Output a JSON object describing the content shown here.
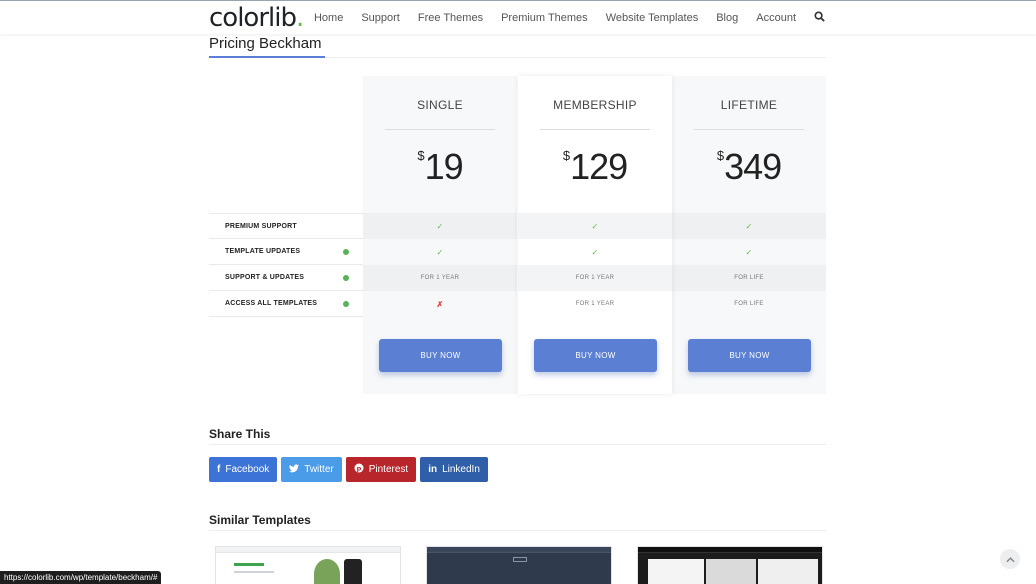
{
  "header": {
    "logo_text": "colorlib",
    "logo_dot": ".",
    "nav": [
      "Home",
      "Support",
      "Free Themes",
      "Premium Themes",
      "Website Templates",
      "Blog",
      "Account"
    ]
  },
  "page": {
    "title": "Pricing Beckham"
  },
  "pricing": {
    "features": [
      {
        "label": "PREMIUM SUPPORT",
        "help": false
      },
      {
        "label": "TEMPLATE UPDATES",
        "help": true
      },
      {
        "label": "SUPPORT & UPDATES",
        "help": true
      },
      {
        "label": "ACCESS ALL TEMPLATES",
        "help": true
      }
    ],
    "plans": [
      {
        "name": "SINGLE",
        "currency": "$",
        "price": "19",
        "cells": [
          "✓",
          "✓",
          "FOR 1 YEAR",
          "✗"
        ],
        "button": "BUY NOW"
      },
      {
        "name": "MEMBERSHIP",
        "currency": "$",
        "price": "129",
        "cells": [
          "✓",
          "✓",
          "FOR 1 YEAR",
          "FOR 1 YEAR"
        ],
        "button": "BUY NOW"
      },
      {
        "name": "LIFETIME",
        "currency": "$",
        "price": "349",
        "cells": [
          "✓",
          "✓",
          "FOR LIFE",
          "FOR LIFE"
        ],
        "button": "BUY NOW"
      }
    ]
  },
  "share": {
    "title": "Share This",
    "buttons": [
      {
        "label": "Facebook",
        "icon": "f",
        "color": "#3b74d6"
      },
      {
        "label": "Twitter",
        "icon": "✦",
        "color": "#4a9be8"
      },
      {
        "label": "Pinterest",
        "icon": "℗",
        "color": "#b8252a"
      },
      {
        "label": "LinkedIn",
        "icon": "in",
        "color": "#2e5fa8"
      }
    ]
  },
  "similar": {
    "title": "Similar Templates"
  },
  "status_bar": {
    "url": "https://colorlib.com/wp/template/beckham/#"
  }
}
